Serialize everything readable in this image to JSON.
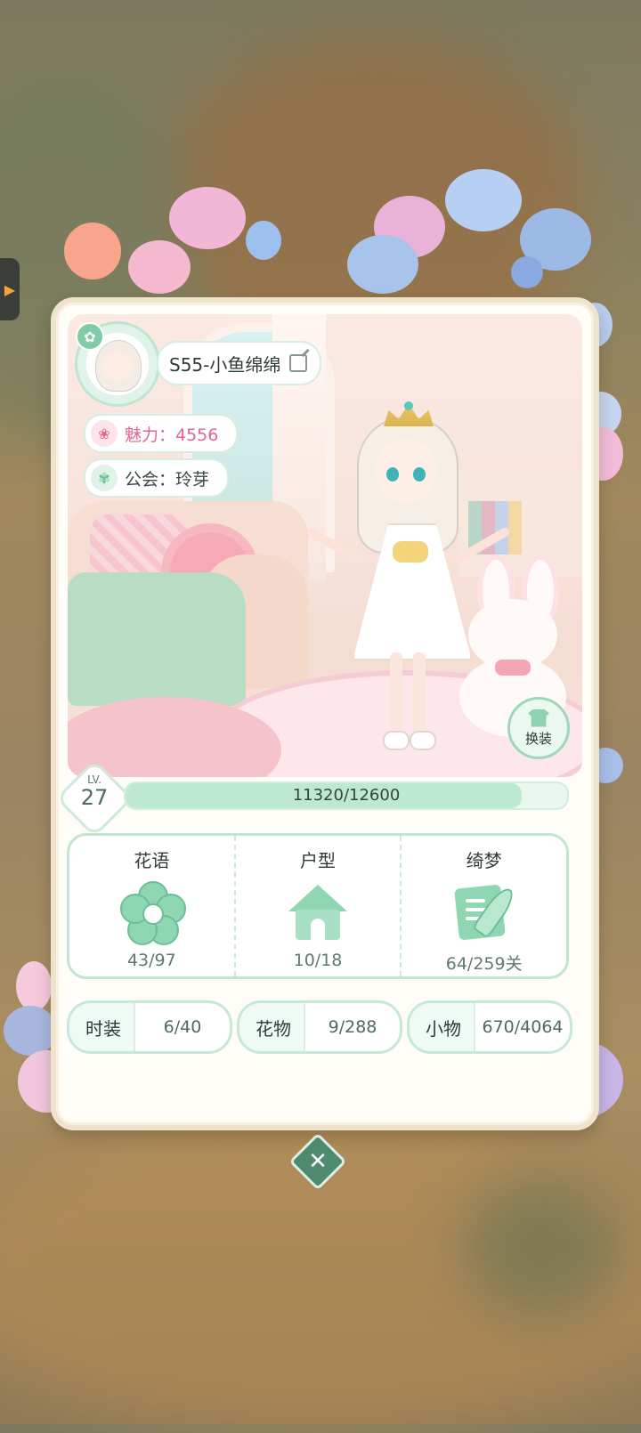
{
  "profile": {
    "name": "S55-小鱼绵绵",
    "charm_label": "魅力：4556",
    "guild_label": "公会：玲芽",
    "dress_button": "换装"
  },
  "level": {
    "label": "LV.",
    "value": "27",
    "xp_text": "11320/12600",
    "xp_fraction": 0.898
  },
  "stats": [
    {
      "title": "花语",
      "value": "43/97",
      "icon": "flower-icon"
    },
    {
      "title": "户型",
      "value": "10/18",
      "icon": "house-icon"
    },
    {
      "title": "绮梦",
      "value": "64/259关",
      "icon": "letter-quill-icon"
    }
  ],
  "collections": [
    {
      "label": "时装",
      "value": "6/40"
    },
    {
      "label": "花物",
      "value": "9/288"
    },
    {
      "label": "小物",
      "value": "670/4064"
    }
  ],
  "colors": {
    "accent": "#8fd6b3",
    "charm": "#e2668e",
    "card": "#fffdf8"
  }
}
